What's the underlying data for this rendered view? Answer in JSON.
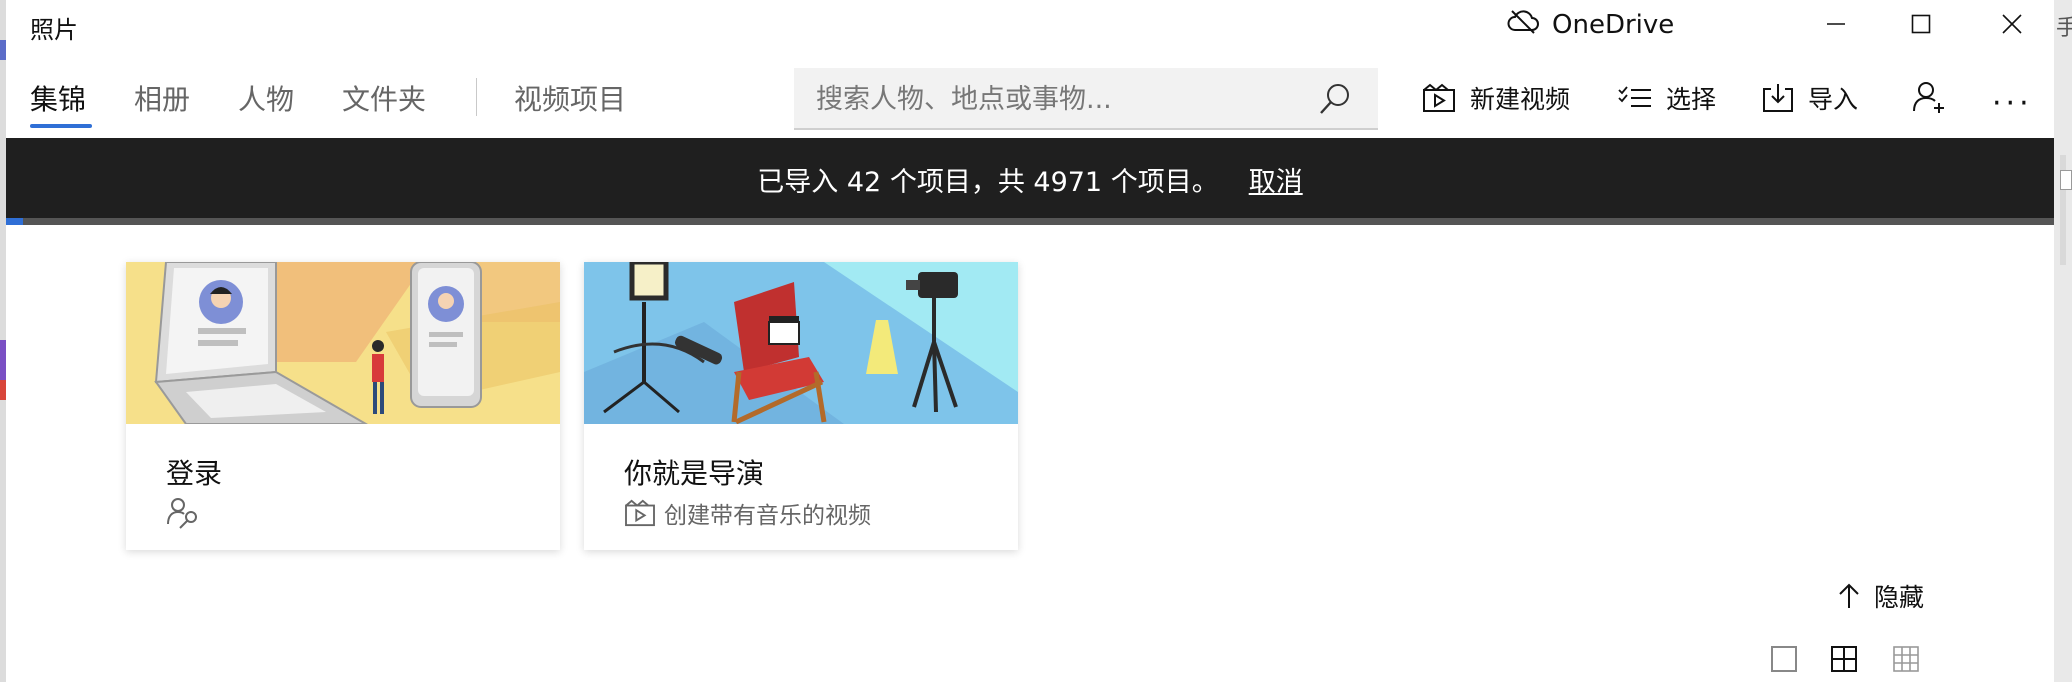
{
  "app": {
    "title": "照片"
  },
  "onedrive": {
    "label": "OneDrive",
    "icon": "cloud-offline-icon"
  },
  "window_controls": [
    "minimize-icon",
    "maximize-icon",
    "close-icon"
  ],
  "nav": {
    "tabs": [
      {
        "label": "集锦",
        "active": true
      },
      {
        "label": "相册",
        "active": false
      },
      {
        "label": "人物",
        "active": false
      },
      {
        "label": "文件夹",
        "active": false
      },
      {
        "label": "视频项目",
        "active": false
      }
    ]
  },
  "search": {
    "placeholder": "搜索人物、地点或事物...",
    "icon": "search-icon"
  },
  "commands": {
    "new_video": "新建视频",
    "select": "选择",
    "import": "导入",
    "more": "···"
  },
  "banner": {
    "message": "已导入 42 个项目，共 4971 个项目。",
    "cancel": "取消",
    "progress_fraction": 0.0085
  },
  "cards": [
    {
      "title": "登录",
      "subtitle": "",
      "icon": "people-key-icon"
    },
    {
      "title": "你就是导演",
      "subtitle": "创建带有音乐的视频",
      "icon": "video-clip-icon"
    }
  ],
  "footer": {
    "hide_label": "隐藏",
    "view_modes": [
      "large-tile-view-icon",
      "medium-grid-view-icon",
      "small-grid-view-icon"
    ]
  },
  "colors": {
    "accent": "#2f6fd6",
    "banner_bg": "#1f1f1f"
  }
}
